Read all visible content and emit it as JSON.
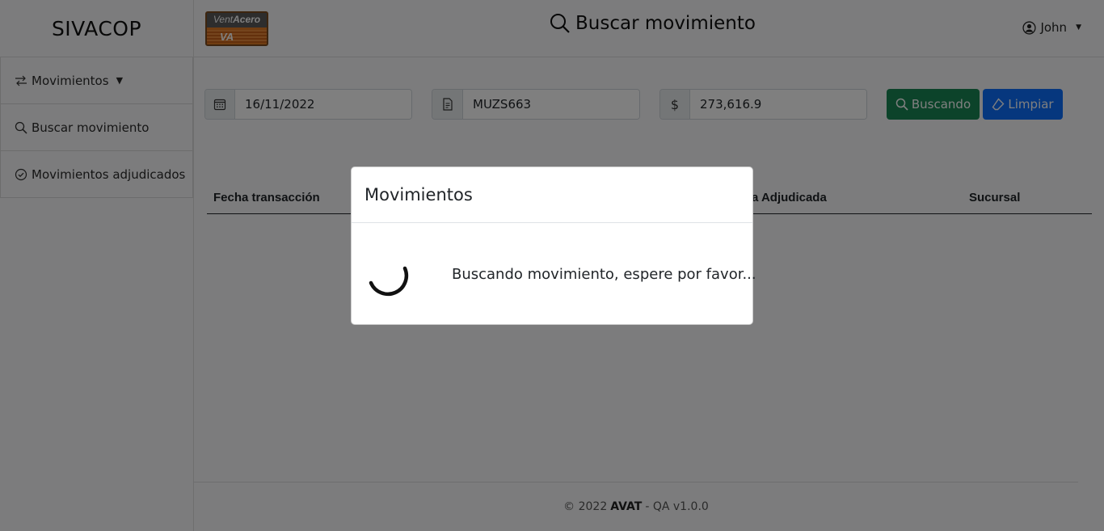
{
  "app": {
    "brand": "SIVACOP",
    "page_title": "Buscar movimiento",
    "user_name": "John",
    "logo": {
      "top_text_a": "Vent",
      "top_text_b": "Acero",
      "bottom_text": "VA"
    }
  },
  "sidebar": {
    "items": [
      {
        "label": "Movimientos",
        "icon": "arrows-exchange-icon",
        "has_caret": true
      },
      {
        "label": "Buscar movimiento",
        "icon": "search-icon"
      },
      {
        "label": "Movimientos adjudicados",
        "icon": "check-circle-icon"
      }
    ]
  },
  "search": {
    "date_value": "16/11/2022",
    "reference_value": "MUZS663",
    "amount_prefix": "$",
    "amount_value": "273,616.9",
    "search_button_label": "Buscando",
    "clear_button_label": "Limpiar"
  },
  "table": {
    "columns": [
      "Fecha transacción",
      "a Adjudicada",
      "Sucursal"
    ]
  },
  "footer": {
    "copyright": "© 2022",
    "company": "AVAT",
    "version": "- QA v1.0.0"
  },
  "modal": {
    "title": "Movimientos",
    "message": "Buscando movimiento, espere por favor..."
  },
  "colors": {
    "success": "#198754",
    "primary": "#0d6efd",
    "backdrop": "rgba(0,0,0,0.5)"
  }
}
